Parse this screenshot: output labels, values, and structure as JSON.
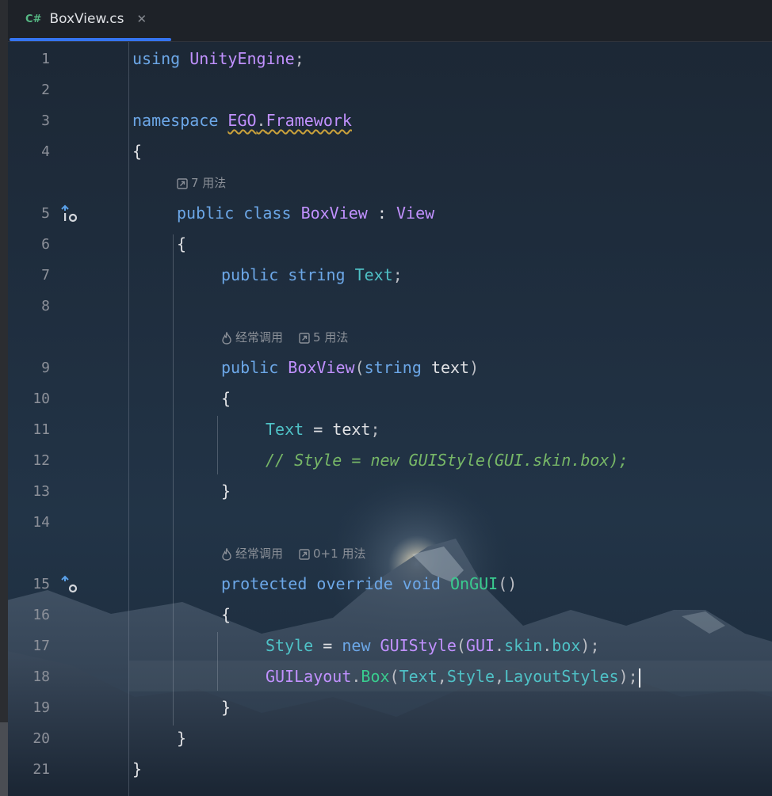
{
  "tab": {
    "icon_label": "C#",
    "title": "BoxView.cs",
    "close_glyph": "✕"
  },
  "editor": {
    "lines": [
      {
        "num": "1"
      },
      {
        "num": "2"
      },
      {
        "num": "3"
      },
      {
        "num": "4"
      },
      {
        "num": "5"
      },
      {
        "num": "6"
      },
      {
        "num": "7"
      },
      {
        "num": "8"
      },
      {
        "num": "9"
      },
      {
        "num": "10"
      },
      {
        "num": "11"
      },
      {
        "num": "12"
      },
      {
        "num": "13"
      },
      {
        "num": "14"
      },
      {
        "num": "15"
      },
      {
        "num": "16"
      },
      {
        "num": "17"
      },
      {
        "num": "18"
      },
      {
        "num": "19"
      },
      {
        "num": "20"
      },
      {
        "num": "21"
      }
    ],
    "hints": {
      "class_usages": "7 用法",
      "ctor_frequent": "经常调用",
      "ctor_usages": "5 用法",
      "ongui_frequent": "经常调用",
      "ongui_usages": "0+1 用法"
    },
    "tokens": {
      "using": "using",
      "unity_engine": "UnityEngine",
      "semi": ";",
      "namespace": "namespace",
      "ns_ego": "EGO",
      "dot": ".",
      "ns_framework": "Framework",
      "lbrace": "{",
      "rbrace": "}",
      "public": "public",
      "class": "class",
      "box_view": "BoxView",
      "colon": ":",
      "view": "View",
      "string": "string",
      "text_field": "Text",
      "lparen": "(",
      "rparen": ")",
      "text_param": "text",
      "equals": "=",
      "comment": "// Style = new GUIStyle(GUI.skin.box);",
      "protected": "protected",
      "override": "override",
      "void": "void",
      "on_gui": "OnGUI",
      "parens": "()",
      "style": "Style",
      "new": "new",
      "gui_style": "GUIStyle",
      "gui": "GUI",
      "skin": "skin",
      "box": "box",
      "gui_layout": "GUILayout",
      "box_method": "Box",
      "comma": ",",
      "layout_styles": "LayoutStyles",
      "close_semi": ");"
    }
  },
  "colors": {
    "keyword": "#6ca7e7",
    "type": "#c191ff",
    "field": "#4fc1c6",
    "method": "#39cc8f",
    "comment": "#77b767",
    "tab_accent": "#3574f0"
  },
  "icons": [
    "csharp-file-icon",
    "close-icon",
    "implemented-icon",
    "override-icon",
    "usages-icon",
    "fire-icon"
  ]
}
